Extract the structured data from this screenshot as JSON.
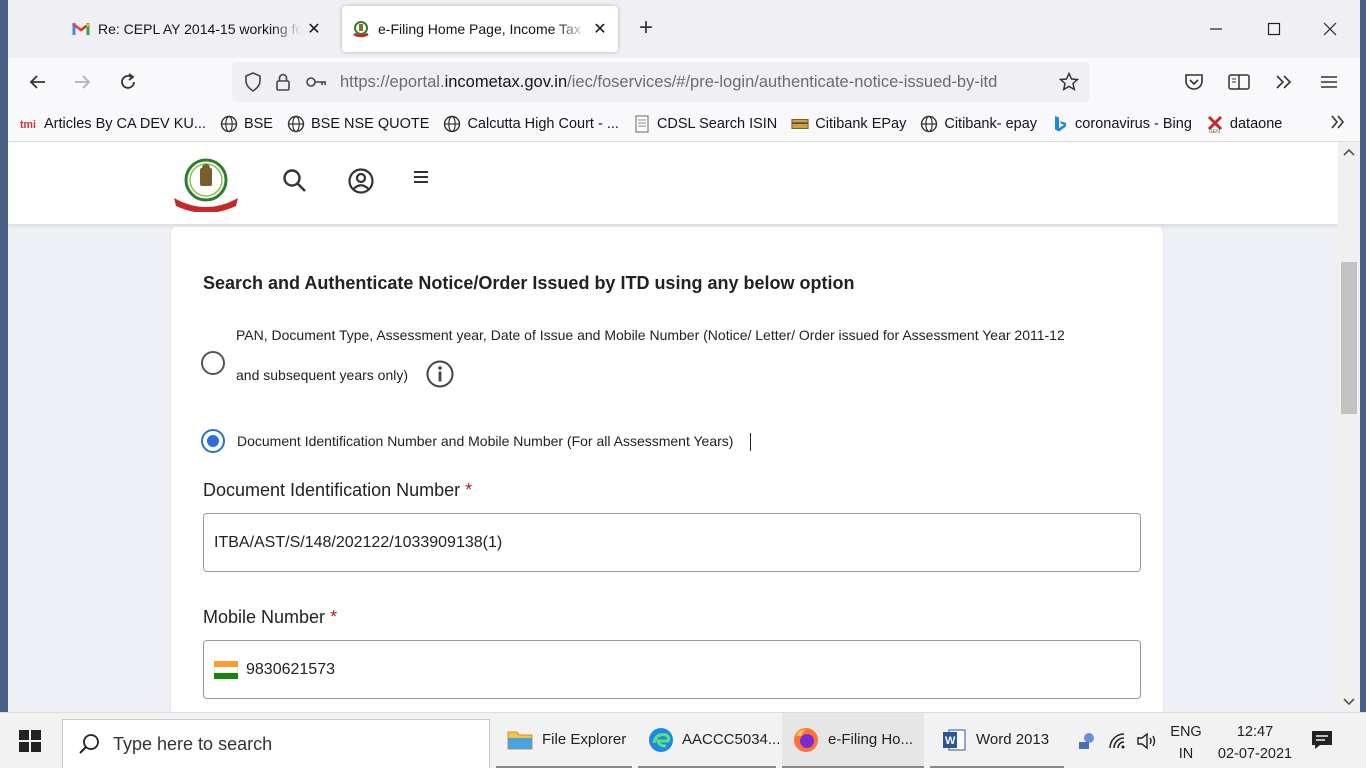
{
  "browser": {
    "tabs": [
      {
        "title": "Re: CEPL AY 2014-15 working fo",
        "favicon": "gmail-icon",
        "active": false
      },
      {
        "title": "e-Filing Home Page, Income Tax",
        "favicon": "itd-emblem-icon",
        "active": true
      }
    ],
    "url": {
      "prefix": "https://eportal.",
      "domain": "incometax.gov.in",
      "path": "/iec/foservices/#/pre-login/authenticate-notice-issued-by-itd"
    },
    "bookmarks": [
      {
        "label": "Articles By CA DEV KU...",
        "icon": "tmi-icon"
      },
      {
        "label": "BSE",
        "icon": "globe-icon"
      },
      {
        "label": "BSE NSE QUOTE",
        "icon": "globe-icon"
      },
      {
        "label": "Calcutta High Court - ...",
        "icon": "globe-icon"
      },
      {
        "label": "CDSL Search ISIN",
        "icon": "document-icon"
      },
      {
        "label": "Citibank EPay",
        "icon": "card-icon"
      },
      {
        "label": "Citibank- epay",
        "icon": "globe-icon"
      },
      {
        "label": "coronavirus - Bing",
        "icon": "bing-icon"
      },
      {
        "label": "dataone",
        "icon": "dataone-icon"
      }
    ]
  },
  "page": {
    "title": "Search and Authenticate Notice/Order Issued by ITD using any below option",
    "option1_line1": "PAN, Document Type, Assessment year, Date of Issue and Mobile Number (Notice/ Letter/ Order issued for Assessment Year 2011-12",
    "option1_line2": "and subsequent years only)",
    "option2": "Document Identification Number and Mobile Number (For all Assessment Years)",
    "din_label": "Document Identification Number",
    "din_value": "ITBA/AST/S/148/202122/1033909138(1)",
    "mobile_label": "Mobile Number",
    "mobile_value": "9830621573",
    "required_mark": "*"
  },
  "taskbar": {
    "search_placeholder": "Type here to search",
    "apps": [
      {
        "label": "File Explorer",
        "icon": "folder-icon"
      },
      {
        "label": "AACCC5034...",
        "icon": "edge-icon"
      },
      {
        "label": "e-Filing Ho...",
        "icon": "firefox-icon"
      },
      {
        "label": "Word 2013",
        "icon": "word-icon"
      }
    ],
    "lang_line1": "ENG",
    "lang_line2": "IN",
    "time": "12:47",
    "date": "02-07-2021"
  },
  "colors": {
    "accent": "#2c6fd6",
    "required": "#b01c1c"
  }
}
